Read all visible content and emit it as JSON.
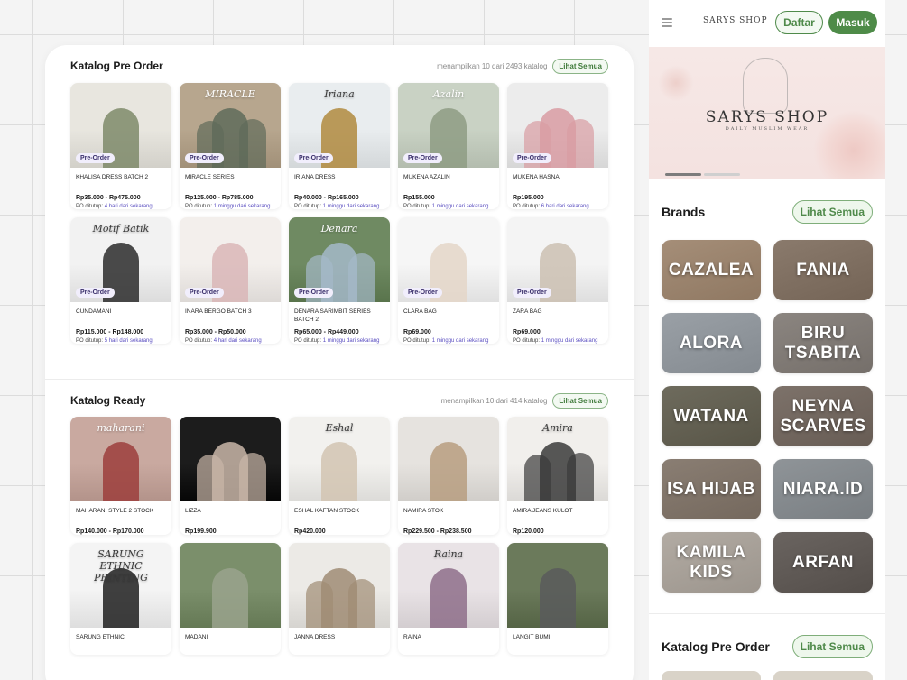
{
  "colors": {
    "accent": "#4e8b48",
    "badge_text": "#3a2f6b",
    "po_link": "#5a4ec0"
  },
  "preorder": {
    "title": "Katalog Pre Order",
    "count_text": "menampilkan 10 dari 2493 katalog",
    "see_all": "Lihat Semua",
    "po_label": "PO ditutup:",
    "badge": "Pre-Order",
    "items": [
      {
        "name": "KHALISA DRESS BATCH 2",
        "price": "Rp35.000 - Rp475.000",
        "po": "4 hari dari sekarang"
      },
      {
        "name": "MIRACLE SERIES",
        "price": "Rp125.000 - Rp785.000",
        "po": "1 minggu dari sekarang",
        "caption": "MIRACLE"
      },
      {
        "name": "IRIANA DRESS",
        "price": "Rp40.000 - Rp165.000",
        "po": "1 minggu dari sekarang",
        "caption": "Iriana"
      },
      {
        "name": "MUKENA AZALIN",
        "price": "Rp155.000",
        "po": "1 minggu dari sekarang",
        "caption": "Azalin"
      },
      {
        "name": "MUKENA HASNA",
        "price": "Rp195.000",
        "po": "6 hari dari sekarang"
      },
      {
        "name": "CUNDAMANI",
        "price": "Rp115.000 - Rp148.000",
        "po": "5 hari dari sekarang",
        "caption": "Motif Batik"
      },
      {
        "name": "INARA BERGO BATCH 3",
        "price": "Rp35.000 - Rp50.000",
        "po": "4 hari dari sekarang"
      },
      {
        "name": "DENARA SARIMBIT SERIES BATCH 2",
        "price": "Rp65.000 - Rp449.000",
        "po": "1 minggu dari sekarang",
        "caption": "Denara"
      },
      {
        "name": "CLARA BAG",
        "price": "Rp69.000",
        "po": "1 minggu dari sekarang"
      },
      {
        "name": "ZARA BAG",
        "price": "Rp69.000",
        "po": "1 minggu dari sekarang"
      }
    ]
  },
  "ready": {
    "title": "Katalog Ready",
    "count_text": "menampilkan 10 dari 414 katalog",
    "see_all": "Lihat Semua",
    "items": [
      {
        "name": "MAHARANI STYLE 2 STOCK",
        "price": "Rp140.000 - Rp170.000",
        "caption": "maharani"
      },
      {
        "name": "LIZZA",
        "price": "Rp199.900"
      },
      {
        "name": "ESHAL KAFTAN STOCK",
        "price": "Rp420.000",
        "caption": "Eshal"
      },
      {
        "name": "NAMIRA STOK",
        "price": "Rp229.500 - Rp238.500"
      },
      {
        "name": "AMIRA JEANS KULOT",
        "price": "Rp120.000",
        "caption": "Amira"
      },
      {
        "name": "SARUNG ETHNIC",
        "price": "",
        "caption": "SARUNG ETHNIC PRINTING"
      },
      {
        "name": "MADANI",
        "price": ""
      },
      {
        "name": "JANNA DRESS",
        "price": ""
      },
      {
        "name": "RAINA",
        "price": "",
        "caption": "Raina"
      },
      {
        "name": "LANGIT BUMI",
        "price": ""
      }
    ]
  },
  "mobile": {
    "logo": "SARYS SHOP",
    "daftar": "Daftar",
    "masuk": "Masuk",
    "hero_title": "SARYS SHOP",
    "hero_sub": "DAILY MUSLIM WEAR",
    "brands_title": "Brands",
    "see_all": "Lihat Semua",
    "brands": [
      "CAZALEA",
      "FANIA",
      "ALORA",
      "BIRU TSABITA",
      "WATANA",
      "NEYNA SCARVES",
      "ISA HIJAB",
      "NIARA.ID",
      "KAMILA KIDS",
      "ARFAN"
    ],
    "catalog_title": "Katalog Pre Order"
  }
}
